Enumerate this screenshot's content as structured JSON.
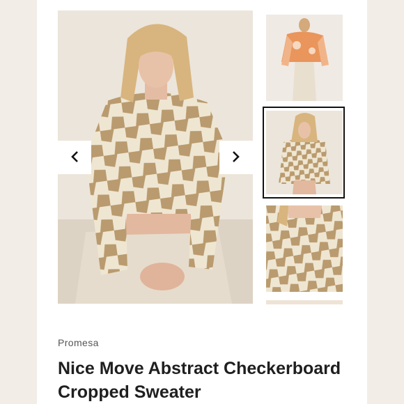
{
  "product": {
    "brand": "Promesa",
    "title": "Nice Move Abstract Checkerboard Cropped Sweater"
  },
  "gallery": {
    "prev_icon": "chevron-left-icon",
    "next_icon": "chevron-right-icon",
    "selected_thumbnail": 2,
    "thumbnail_count": 4
  },
  "colors": {
    "background": "#f3ede8",
    "card": "#ffffff",
    "sweater_tan": "#b99b6f",
    "sweater_cream": "#efe6d2",
    "selection_border": "#111111",
    "title_text": "#1f1f1f"
  }
}
